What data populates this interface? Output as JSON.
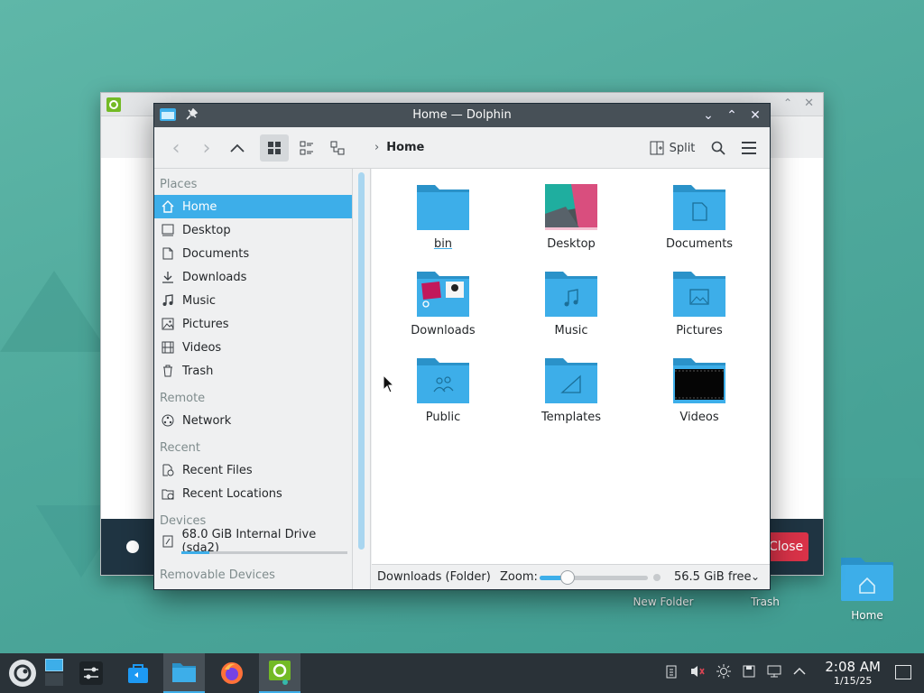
{
  "window": {
    "title": "Home — Dolphin"
  },
  "toolbar": {
    "breadcrumb": "Home",
    "split_label": "Split"
  },
  "sidebar": {
    "sections": {
      "places": "Places",
      "remote": "Remote",
      "recent": "Recent",
      "devices": "Devices",
      "removable": "Removable Devices"
    },
    "places": [
      "Home",
      "Desktop",
      "Documents",
      "Downloads",
      "Music",
      "Pictures",
      "Videos",
      "Trash"
    ],
    "remote": [
      "Network"
    ],
    "recent": [
      "Recent Files",
      "Recent Locations"
    ],
    "devices": [
      "68.0 GiB Internal Drive (sda2)"
    ],
    "drive_used_fraction": 0.17
  },
  "files": [
    "bin",
    "Desktop",
    "Documents",
    "Downloads",
    "Music",
    "Pictures",
    "Public",
    "Templates",
    "Videos"
  ],
  "statusbar": {
    "selection": "Downloads (Folder)",
    "zoom_label": "Zoom:",
    "zoom_fraction": 0.26,
    "free_space": "56.5 GiB free"
  },
  "background_window": {
    "close_label": "Close"
  },
  "desktop_icons": [
    "New Folder",
    "Trash",
    "Home"
  ],
  "taskbar": {
    "time": "2:08 AM",
    "date": "1/15/25"
  },
  "colors": {
    "accent": "#3daee9",
    "folder": "#3daee9",
    "titlebar": "#475057",
    "panel": "#2a3238"
  }
}
